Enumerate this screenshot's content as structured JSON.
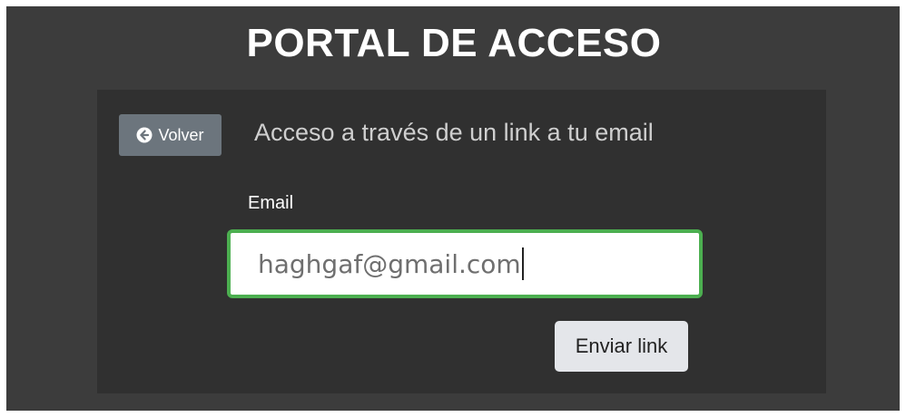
{
  "header": {
    "title": "PORTAL DE ACCESO"
  },
  "card": {
    "back_button": {
      "label": "Volver",
      "icon": "arrow-circle-left-icon"
    },
    "heading": "Acceso a través de un link a tu email",
    "email_label": "Email",
    "email_value": "haghgaf@gmail.com",
    "submit_label": "Enviar link"
  },
  "colors": {
    "page_background": "#3c3c3c",
    "card_background": "#303030",
    "back_button": "#6c757d",
    "input_focus_border": "#4caf50",
    "submit_button": "#e4e6ea"
  }
}
